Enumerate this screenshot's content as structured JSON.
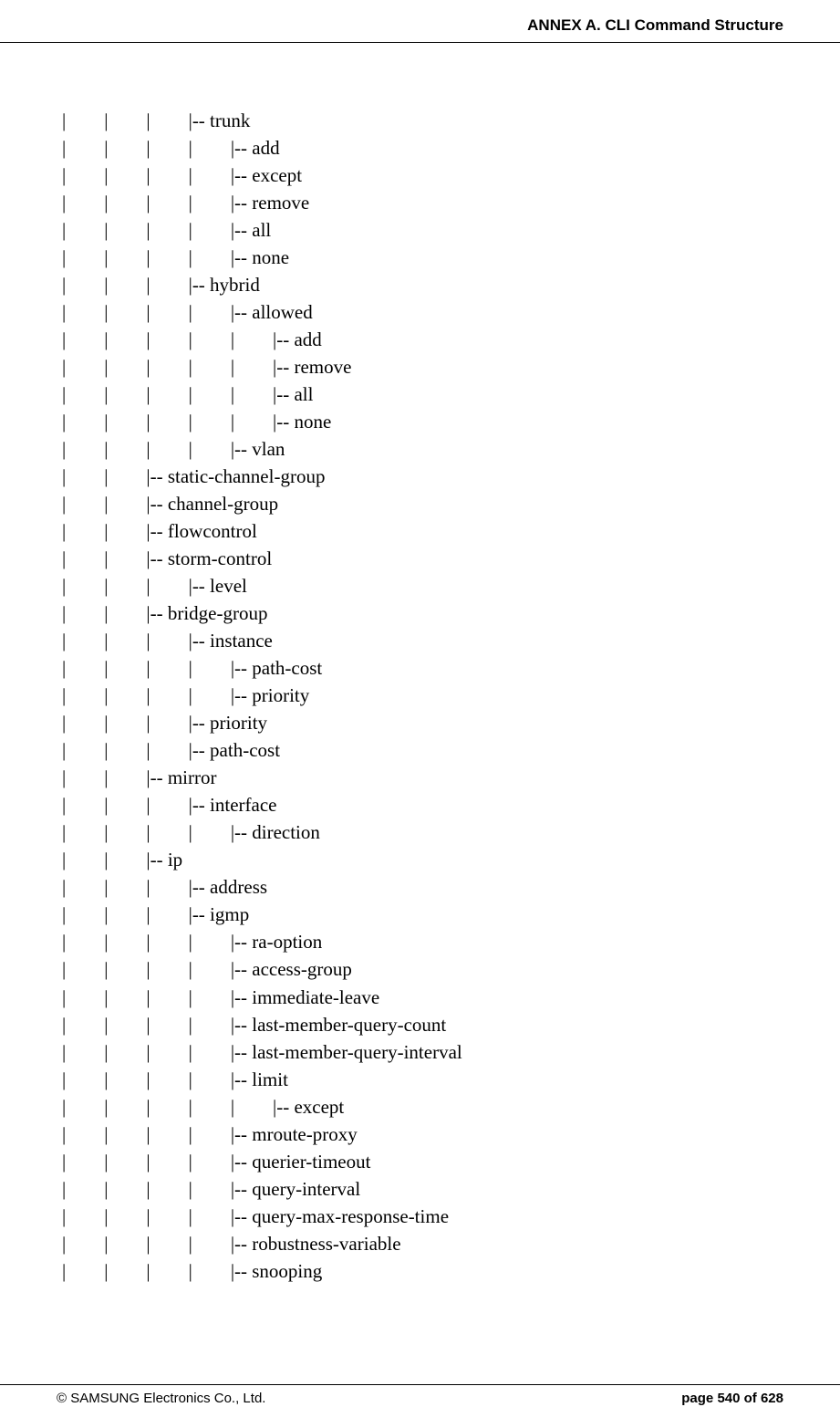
{
  "header": {
    "title": "ANNEX A. CLI Command Structure"
  },
  "lines": [
    "|        |        |        |-- trunk",
    "|        |        |        |        |-- add",
    "|        |        |        |        |-- except",
    "|        |        |        |        |-- remove",
    "|        |        |        |        |-- all",
    "|        |        |        |        |-- none",
    "|        |        |        |-- hybrid",
    "|        |        |        |        |-- allowed",
    "|        |        |        |        |        |-- add",
    "|        |        |        |        |        |-- remove",
    "|        |        |        |        |        |-- all",
    "|        |        |        |        |        |-- none",
    "|        |        |        |        |-- vlan",
    "|        |        |-- static-channel-group",
    "|        |        |-- channel-group",
    "|        |        |-- flowcontrol",
    "|        |        |-- storm-control",
    "|        |        |        |-- level",
    "|        |        |-- bridge-group",
    "|        |        |        |-- instance",
    "|        |        |        |        |-- path-cost",
    "|        |        |        |        |-- priority",
    "|        |        |        |-- priority",
    "|        |        |        |-- path-cost",
    "|        |        |-- mirror",
    "|        |        |        |-- interface",
    "|        |        |        |        |-- direction",
    "|        |        |-- ip",
    "|        |        |        |-- address",
    "|        |        |        |-- igmp",
    "|        |        |        |        |-- ra-option",
    "|        |        |        |        |-- access-group",
    "|        |        |        |        |-- immediate-leave",
    "|        |        |        |        |-- last-member-query-count",
    "|        |        |        |        |-- last-member-query-interval",
    "|        |        |        |        |-- limit",
    "|        |        |        |        |        |-- except",
    "|        |        |        |        |-- mroute-proxy",
    "|        |        |        |        |-- querier-timeout",
    "|        |        |        |        |-- query-interval",
    "|        |        |        |        |-- query-max-response-time",
    "|        |        |        |        |-- robustness-variable",
    "|        |        |        |        |-- snooping"
  ],
  "footer": {
    "copyright": "© SAMSUNG Electronics Co., Ltd.",
    "page": "page 540 of 628"
  }
}
